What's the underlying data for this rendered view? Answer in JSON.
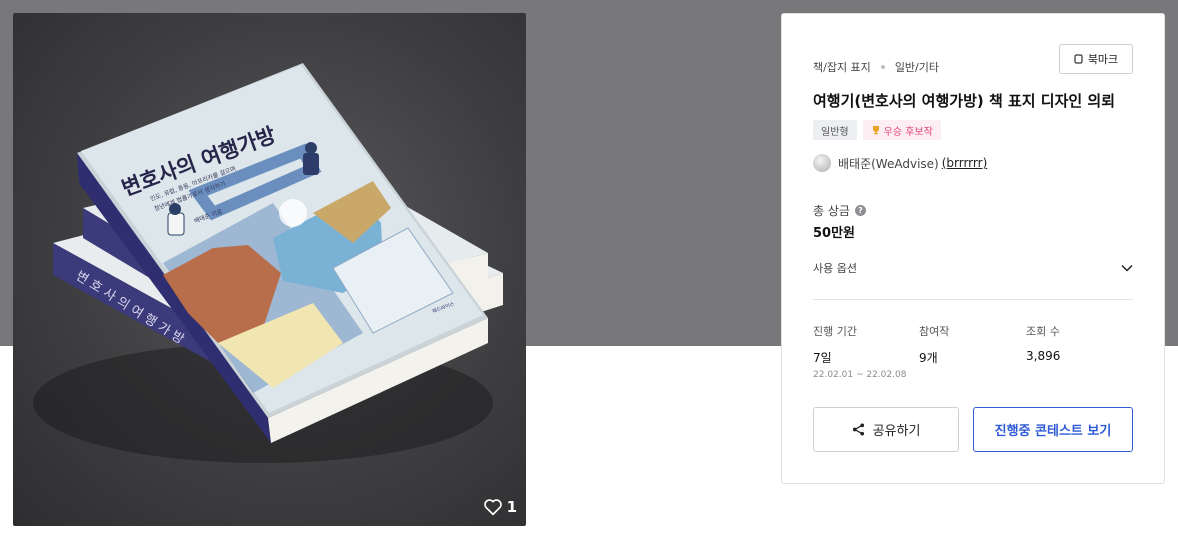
{
  "artwork": {
    "book_title": "변호사의 여행가방",
    "book_subtitle_line1": "인도, 유럽, 중동, 아프리카를 걸으며",
    "book_subtitle_line2": "청년에게 법률가로서 생각하기",
    "book_author": "배태준 지음",
    "publisher_mark": "웨드바이스",
    "like_count": "1"
  },
  "card": {
    "breadcrumb": [
      "책/잡지 표지",
      "일반/기타"
    ],
    "bookmark_label": "북마크",
    "title": "여행기(변호사의 여행가방) 책 표지 디자인 의뢰",
    "tags": [
      "일반형",
      "우승 후보작"
    ],
    "author_name": "배태준(WeAdvise)",
    "author_handle": "(brrrrrr)",
    "prize_label": "총 상금",
    "prize_value": "50만원",
    "usage_label": "사용 옵션",
    "stats": {
      "period_label": "진행 기간",
      "period_value": "7일",
      "period_range": "22.02.01 ~ 22.02.08",
      "entries_label": "참여작",
      "entries_value": "9개",
      "views_label": "조회 수",
      "views_value": "3,896"
    },
    "share_label": "공유하기",
    "view_label": "진행중 콘테스트 보기"
  },
  "colors": {
    "backdrop": "#78777a",
    "accent_blue": "#2f5bd6",
    "winner_pink": "#e0457b",
    "book_spine": "#3b3a7a",
    "book_cover": "#dde6ea"
  }
}
